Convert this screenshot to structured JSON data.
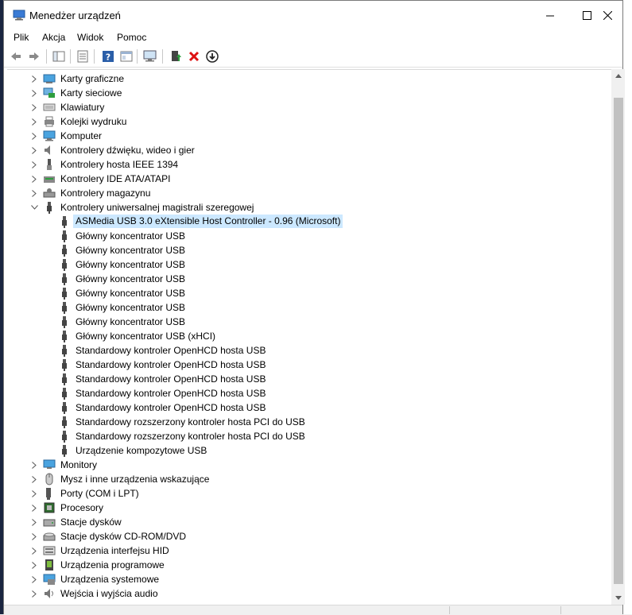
{
  "window": {
    "title": "Menedżer urządzeń"
  },
  "menu": [
    "Plik",
    "Akcja",
    "Widok",
    "Pomoc"
  ],
  "toolbar": {
    "icons": [
      "back-icon",
      "forward-icon",
      "show-hide-tree-icon",
      "properties-icon",
      "help-icon",
      "view-icon",
      "monitor-icon",
      "update-driver-icon",
      "uninstall-icon",
      "disable-icon"
    ]
  },
  "tree": {
    "categories_top": [
      {
        "label": "Karty graficzne",
        "icon": "display-adapter-icon"
      },
      {
        "label": "Karty sieciowe",
        "icon": "network-adapter-icon"
      },
      {
        "label": "Klawiatury",
        "icon": "keyboard-icon"
      },
      {
        "label": "Kolejki wydruku",
        "icon": "printer-icon"
      },
      {
        "label": "Komputer",
        "icon": "computer-icon"
      },
      {
        "label": "Kontrolery dźwięku, wideo i gier",
        "icon": "sound-icon"
      },
      {
        "label": "Kontrolery hosta IEEE 1394",
        "icon": "ieee1394-icon"
      },
      {
        "label": "Kontrolery IDE ATA/ATAPI",
        "icon": "ide-icon"
      },
      {
        "label": "Kontrolery magazynu",
        "icon": "storage-icon"
      }
    ],
    "expanded": {
      "label": "Kontrolery uniwersalnej magistrali szeregowej",
      "icon": "usb-icon"
    },
    "usb_children": [
      {
        "label": "ASMedia USB 3.0 eXtensible Host Controller - 0.96 (Microsoft)",
        "selected": true
      },
      {
        "label": "Główny koncentrator USB"
      },
      {
        "label": "Główny koncentrator USB"
      },
      {
        "label": "Główny koncentrator USB"
      },
      {
        "label": "Główny koncentrator USB"
      },
      {
        "label": "Główny koncentrator USB"
      },
      {
        "label": "Główny koncentrator USB"
      },
      {
        "label": "Główny koncentrator USB"
      },
      {
        "label": "Główny koncentrator USB (xHCI)"
      },
      {
        "label": "Standardowy kontroler OpenHCD hosta USB"
      },
      {
        "label": "Standardowy kontroler OpenHCD hosta USB"
      },
      {
        "label": "Standardowy kontroler OpenHCD hosta USB"
      },
      {
        "label": "Standardowy kontroler OpenHCD hosta USB"
      },
      {
        "label": "Standardowy kontroler OpenHCD hosta USB"
      },
      {
        "label": "Standardowy rozszerzony kontroler hosta PCI do USB"
      },
      {
        "label": "Standardowy rozszerzony kontroler hosta PCI do USB"
      },
      {
        "label": "Urządzenie kompozytowe USB"
      }
    ],
    "categories_bottom": [
      {
        "label": "Monitory",
        "icon": "monitor-icon"
      },
      {
        "label": "Mysz i inne urządzenia wskazujące",
        "icon": "mouse-icon"
      },
      {
        "label": "Porty (COM i LPT)",
        "icon": "port-icon"
      },
      {
        "label": "Procesory",
        "icon": "processor-icon"
      },
      {
        "label": "Stacje dysków",
        "icon": "disk-drive-icon"
      },
      {
        "label": "Stacje dysków CD-ROM/DVD",
        "icon": "cdrom-icon"
      },
      {
        "label": "Urządzenia interfejsu HID",
        "icon": "hid-icon"
      },
      {
        "label": "Urządzenia programowe",
        "icon": "software-device-icon"
      },
      {
        "label": "Urządzenia systemowe",
        "icon": "system-device-icon"
      },
      {
        "label": "Wejścia i wyjścia audio",
        "icon": "audio-io-icon"
      }
    ]
  }
}
